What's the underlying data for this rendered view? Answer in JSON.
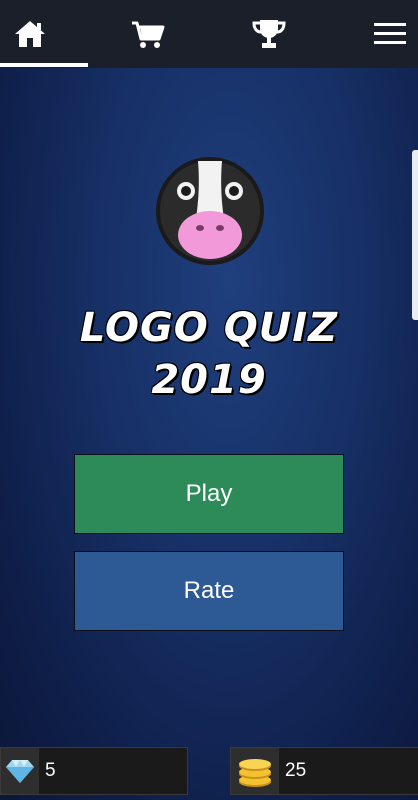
{
  "nav": {
    "tabs": [
      {
        "name": "home",
        "icon": "home-icon",
        "active": true
      },
      {
        "name": "shop",
        "icon": "cart-icon",
        "active": false
      },
      {
        "name": "leaderboard",
        "icon": "trophy-icon",
        "active": false
      },
      {
        "name": "menu",
        "icon": "hamburger-menu-icon",
        "active": false
      }
    ]
  },
  "logo": {
    "icon": "cow-face-icon"
  },
  "title": {
    "line1": "LOGO QUIZ",
    "line2": "2019"
  },
  "buttons": {
    "play_label": "Play",
    "rate_label": "Rate"
  },
  "counters": {
    "gems": {
      "icon": "diamond-icon",
      "value": "5"
    },
    "coins": {
      "icon": "coin-stack-icon",
      "value": "25"
    }
  },
  "colors": {
    "play": "#2d8a59",
    "rate": "#2d5994",
    "topbar": "#1a1f2a",
    "background": "#173066"
  }
}
